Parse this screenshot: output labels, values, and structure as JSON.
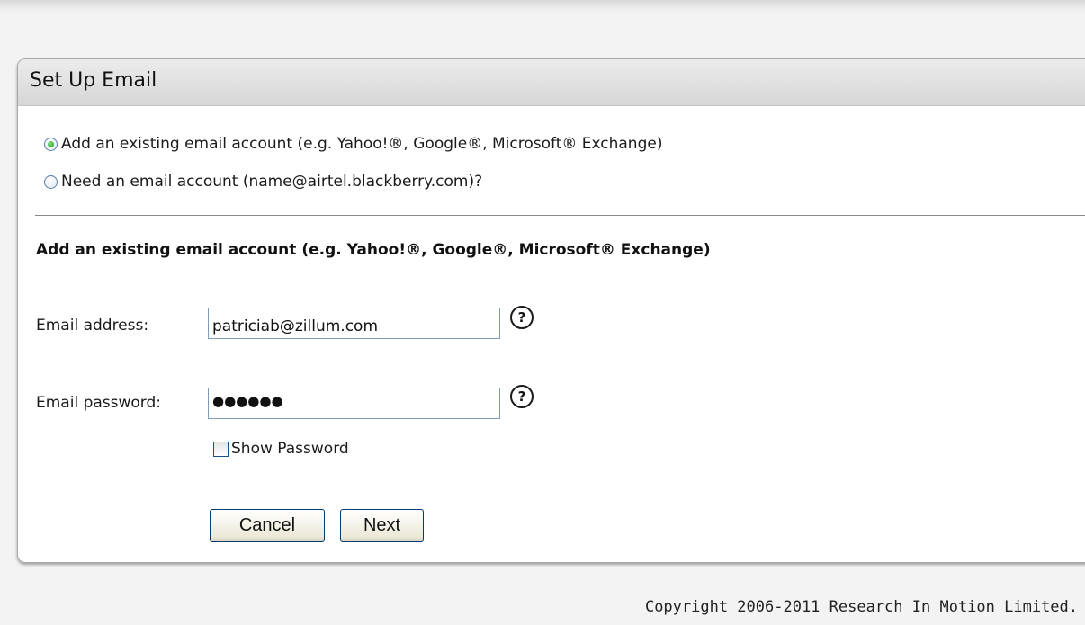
{
  "panel": {
    "title": "Set Up Email"
  },
  "account_choice": {
    "options": [
      {
        "label": "Add an existing email account (e.g. Yahoo!®, Google®, Microsoft® Exchange)",
        "selected": true
      },
      {
        "label": "Need an email account (name@airtel.blackberry.com)?",
        "selected": false
      }
    ]
  },
  "form": {
    "heading": "Add an existing email account (e.g. Yahoo!®, Google®, Microsoft® Exchange)",
    "email_label": "Email address:",
    "email_value": "patriciab@zillum.com",
    "password_label": "Email password:",
    "password_mask": "●●●●●●",
    "help_symbol": "?",
    "show_password_label": "Show Password",
    "show_password_checked": false,
    "cancel_label": "Cancel",
    "next_label": "Next"
  },
  "footer": {
    "copyright": "Copyright 2006-2011 Research In Motion Limited."
  },
  "colors": {
    "radio_selected": "#2bb02b",
    "input_border": "#7f9db9",
    "button_border": "#003c74"
  }
}
